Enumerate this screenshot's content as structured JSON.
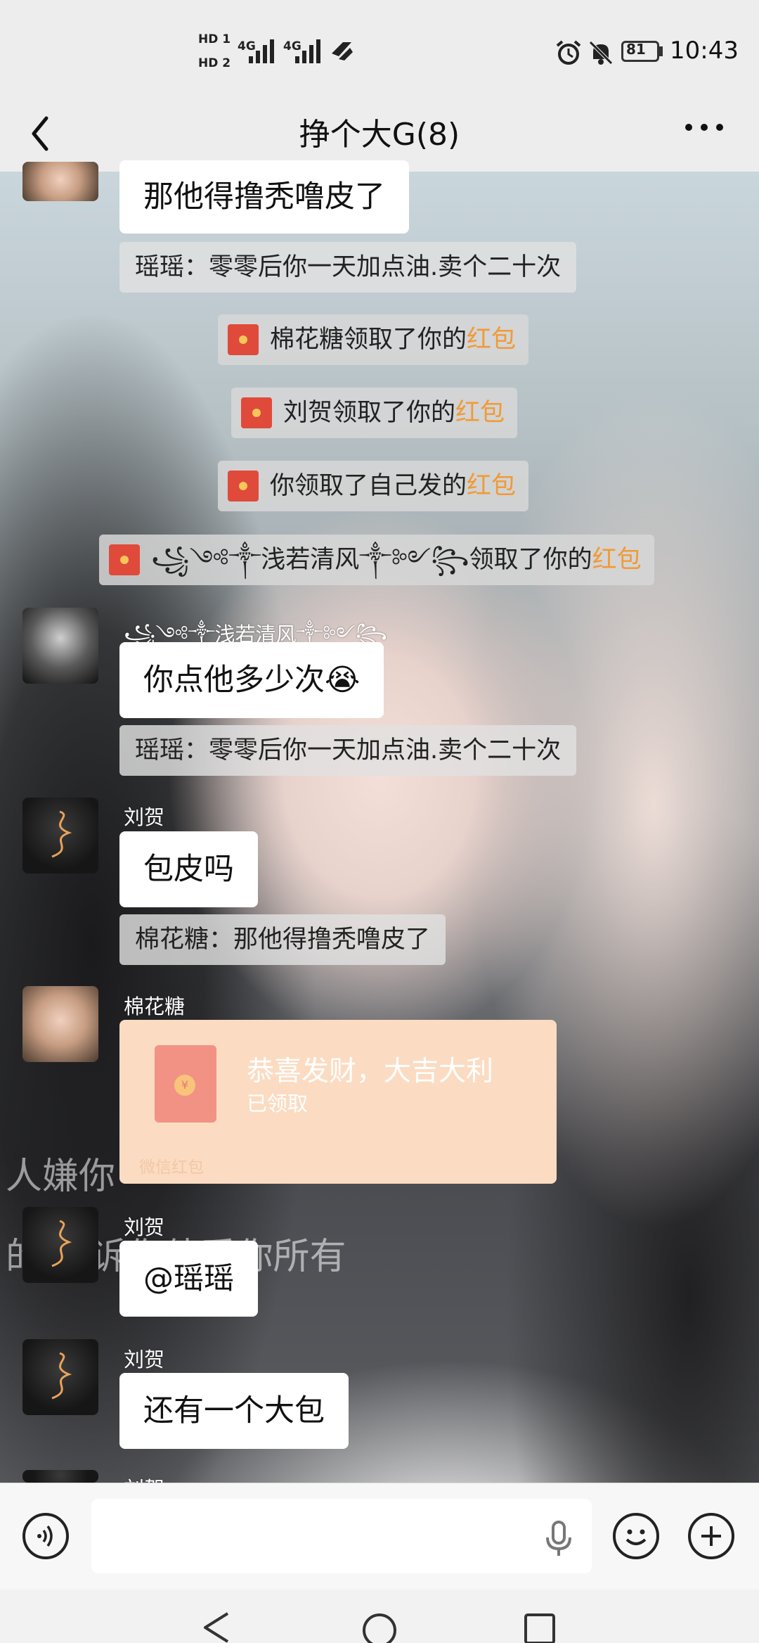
{
  "status_bar": {
    "sim1": "HD 1",
    "sim2": "HD 2",
    "network1": "4G",
    "network2": "4G",
    "battery": "81",
    "time": "10:43",
    "icons": [
      "alarm-icon",
      "mute-icon",
      "battery-icon"
    ]
  },
  "header": {
    "back_icon": "chevron-left-icon",
    "title": "挣个大G(8)",
    "more_icon": "more-icon"
  },
  "background_overlay": {
    "line1": "人嫌你",
    "line2": "的 告诉你他爱你所有"
  },
  "messages": [
    {
      "sender": "",
      "text": "那他得撸秃噜皮了"
    },
    {
      "quote": "瑶瑶：零零后你一天加点油.卖个二十次"
    },
    {
      "system": {
        "prefix": "棉花糖领取了你的",
        "highlight": "红包"
      }
    },
    {
      "system": {
        "prefix": "刘贺领取了你的",
        "highlight": "红包"
      }
    },
    {
      "system": {
        "prefix": "你领取了自己发的",
        "highlight": "红包"
      }
    },
    {
      "system": {
        "prefix": "꧁༺༒浅若清风༒༻꧂领取了你的",
        "highlight": "红包"
      }
    },
    {
      "sender": "꧁༺༒浅若清风༒༻꧂",
      "text": "你点他多少次😭"
    },
    {
      "quote": "瑶瑶：零零后你一天加点油.卖个二十次"
    },
    {
      "sender": "刘贺",
      "text": "包皮吗"
    },
    {
      "quote": "棉花糖：那他得撸秃噜皮了"
    },
    {
      "sender": "棉花糖",
      "red_packet": {
        "title": "恭喜发财，大吉大利",
        "status": "已领取",
        "brand": "微信红包",
        "coin": "¥"
      }
    },
    {
      "sender": "刘贺",
      "text": "@瑶瑶"
    },
    {
      "sender": "刘贺",
      "text": "还有一个大包"
    },
    {
      "sender": "刘贺",
      "text": ""
    }
  ],
  "input_bar": {
    "voice_icon": "voice-icon",
    "mic_icon": "mic-icon",
    "emoji_icon": "emoji-icon",
    "plus_icon": "plus-icon",
    "value": ""
  },
  "nav_bar": {
    "back_icon": "triangle-back-icon",
    "home_icon": "circle-home-icon",
    "recent_icon": "square-recent-icon"
  },
  "colors": {
    "red_packet_highlight": "#f19a35",
    "packet_bg": "#fbdcc2"
  }
}
